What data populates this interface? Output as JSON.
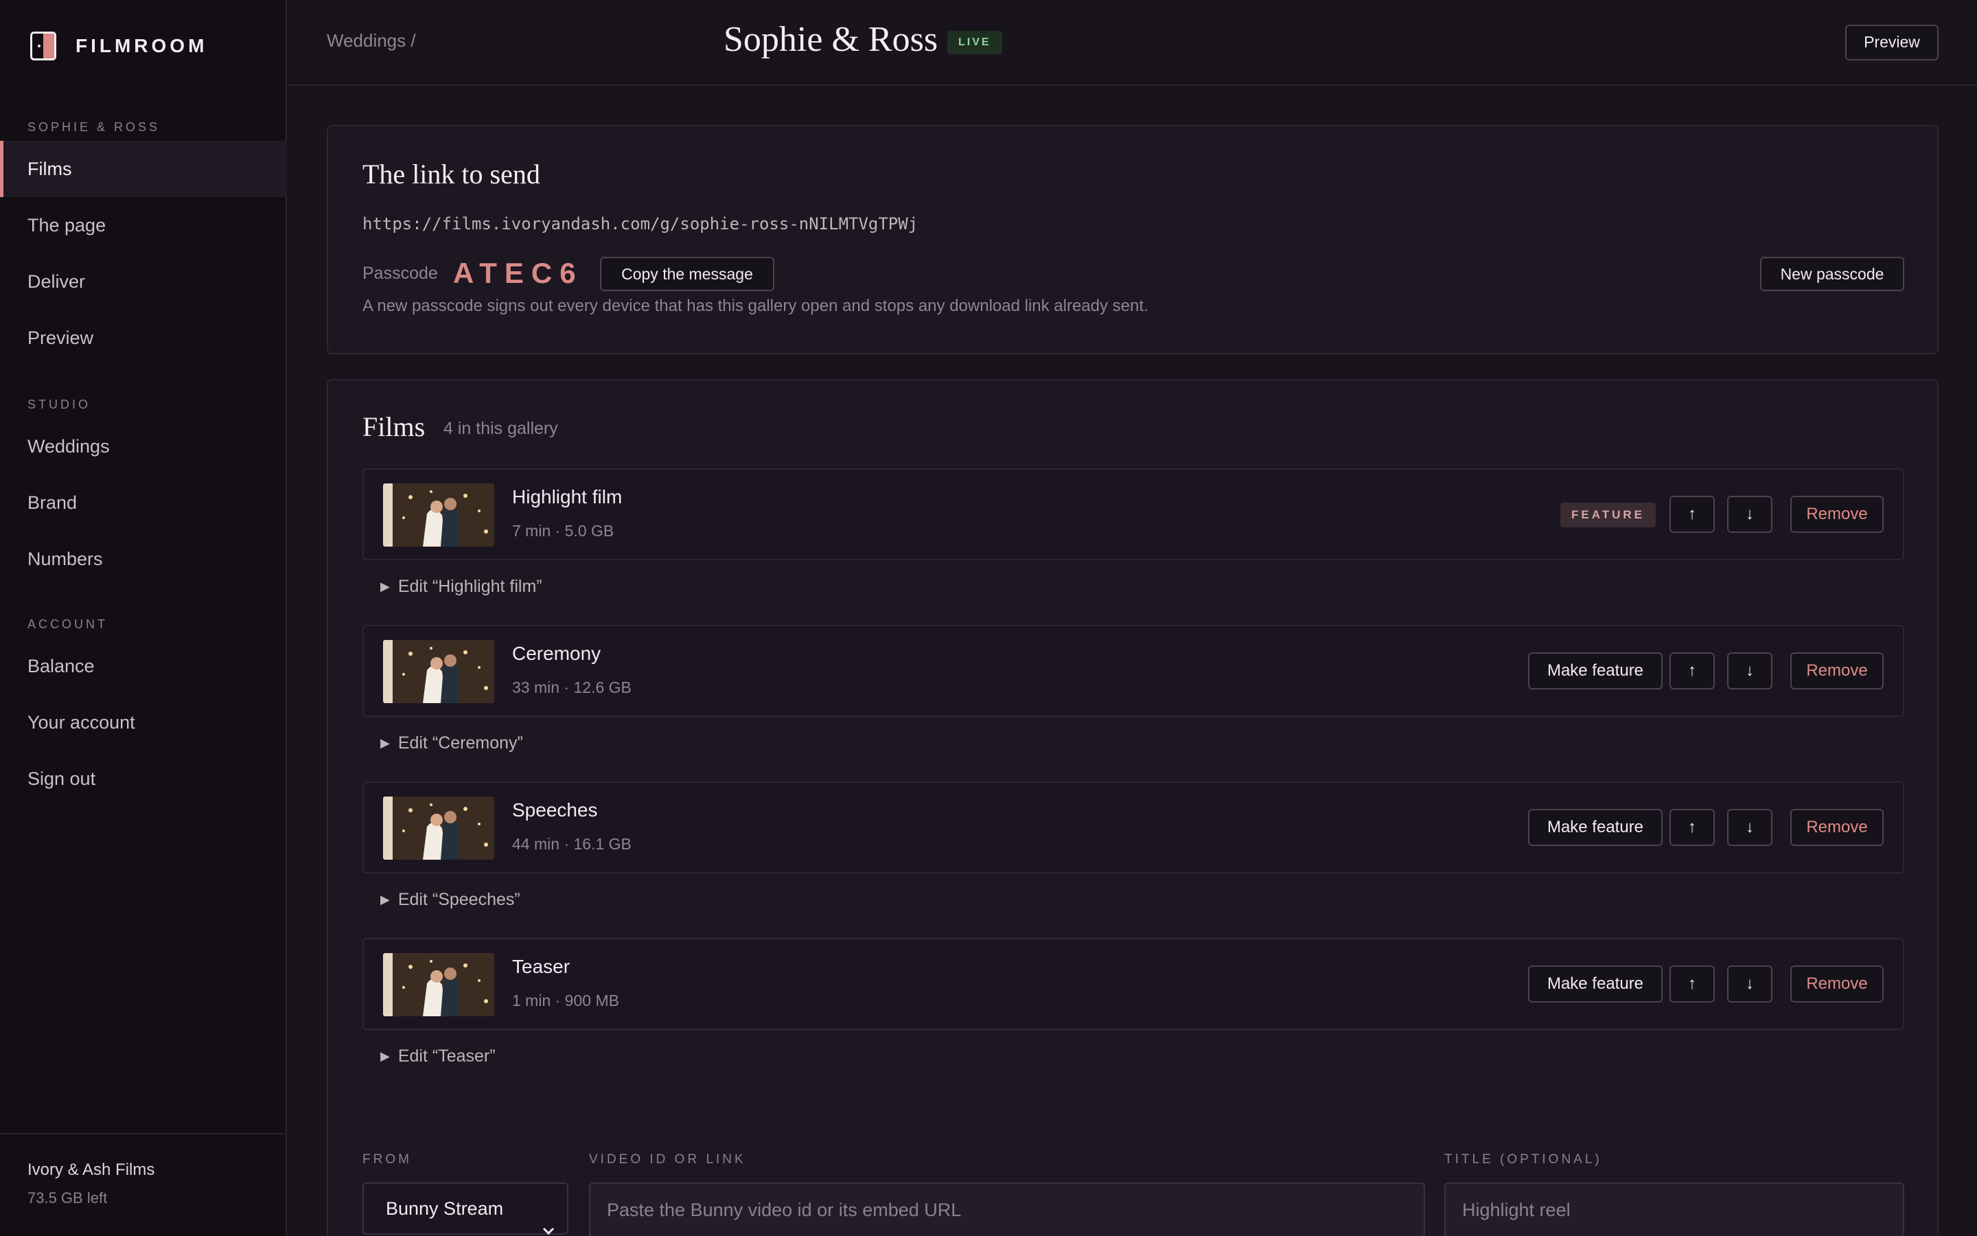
{
  "app": {
    "name": "FILMROOM"
  },
  "sidebar": {
    "groups": [
      {
        "heading": "SOPHIE & ROSS",
        "items": [
          "Films",
          "The page",
          "Deliver",
          "Preview"
        ]
      },
      {
        "heading": "STUDIO",
        "items": [
          "Weddings",
          "Brand",
          "Numbers"
        ]
      },
      {
        "heading": "ACCOUNT",
        "items": [
          "Balance",
          "Your account",
          "Sign out"
        ]
      }
    ],
    "active": "Films",
    "footer": {
      "studio": "Ivory & Ash Films",
      "storage": "73.5 GB left"
    }
  },
  "header": {
    "breadcrumb": "Weddings /",
    "title": "Sophie & Ross",
    "status": "LIVE",
    "preview_label": "Preview"
  },
  "link_card": {
    "title": "The link to send",
    "url": "https://films.ivoryandash.com/g/sophie-ross-nNILMTVgTPWj",
    "passcode_label": "Passcode",
    "passcode": "ATEC6",
    "copy_label": "Copy the message",
    "new_passcode_label": "New passcode",
    "hint": "A new passcode signs out every device that has this gallery open and stops any download link already sent."
  },
  "films": {
    "title": "Films",
    "count_label": "4 in this gallery",
    "feature_tag": "FEATURE",
    "make_feature_label": "Make feature",
    "remove_label": "Remove",
    "up_icon": "arrow-up-icon",
    "down_icon": "arrow-down-icon",
    "items": [
      {
        "name": "Highlight film",
        "meta": "7 min · 5.0 GB",
        "featured": true,
        "edit": "Edit “Highlight film”"
      },
      {
        "name": "Ceremony",
        "meta": "33 min · 12.6 GB",
        "featured": false,
        "edit": "Edit “Ceremony”"
      },
      {
        "name": "Speeches",
        "meta": "44 min · 16.1 GB",
        "featured": false,
        "edit": "Edit “Speeches”"
      },
      {
        "name": "Teaser",
        "meta": "1 min · 900 MB",
        "featured": false,
        "edit": "Edit “Teaser”"
      }
    ]
  },
  "add_form": {
    "from_label": "FROM",
    "from_value": "Bunny Stream",
    "video_label": "VIDEO ID OR LINK",
    "video_placeholder": "Paste the Bunny video id or its embed URL",
    "title_label": "TITLE (OPTIONAL)",
    "title_placeholder": "Highlight reel"
  },
  "colors": {
    "accent": "#d98a86",
    "live": "#8fd49c",
    "background": "#19141c",
    "sidebar": "#120e14"
  }
}
